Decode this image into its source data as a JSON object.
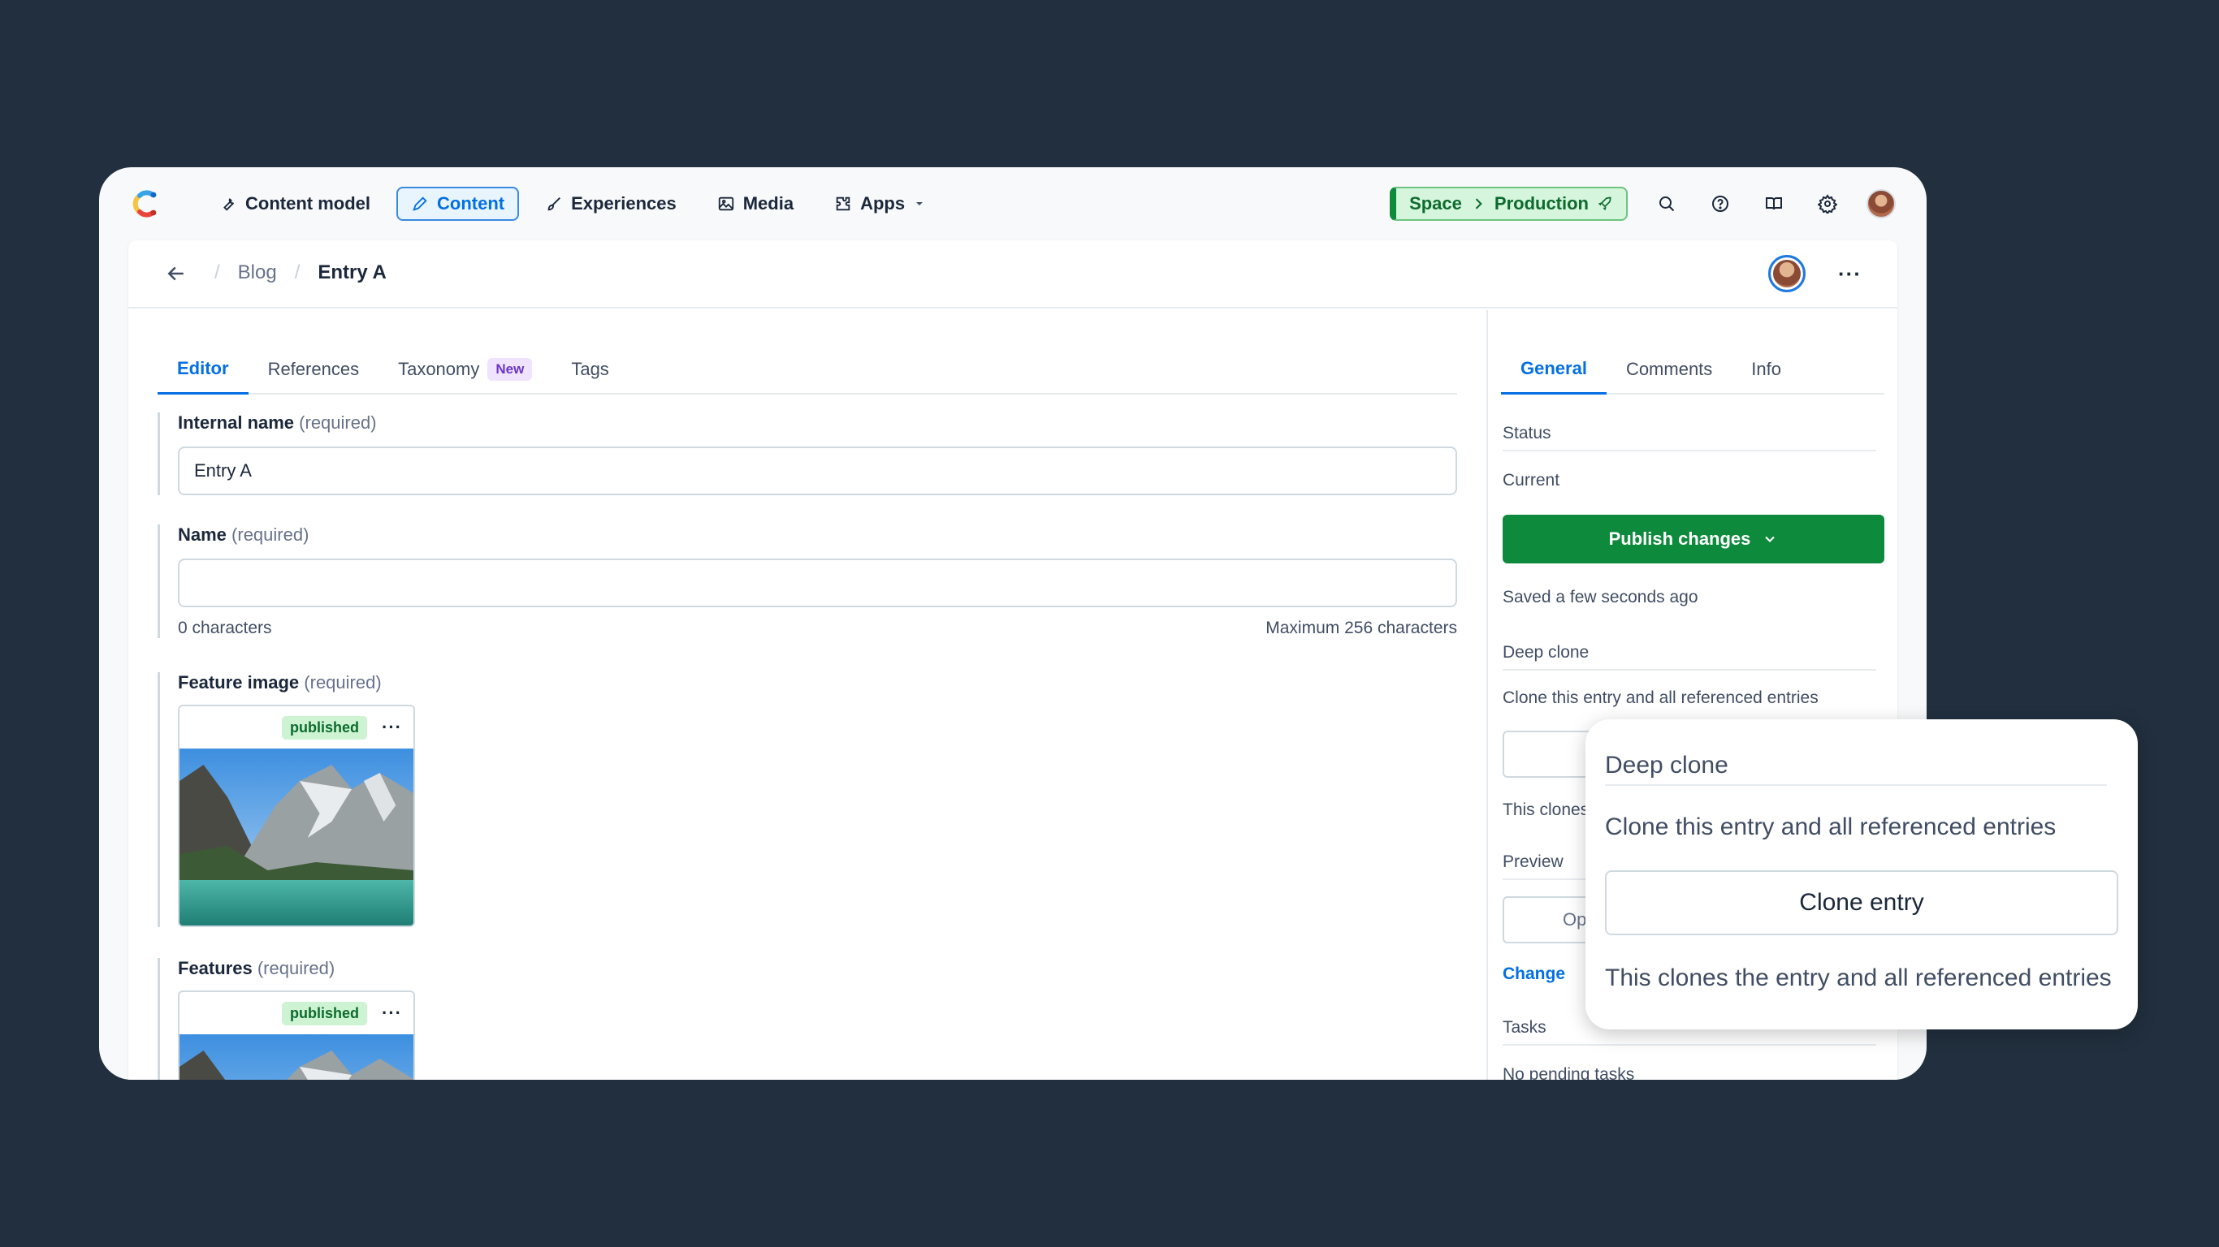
{
  "nav": {
    "items": [
      {
        "label": "Content model",
        "icon": "wrench-icon"
      },
      {
        "label": "Content",
        "icon": "pen-icon",
        "active": true
      },
      {
        "label": "Experiences",
        "icon": "brush-icon"
      },
      {
        "label": "Media",
        "icon": "image-icon"
      },
      {
        "label": "Apps",
        "icon": "puzzle-icon"
      }
    ],
    "environment": {
      "space": "Space",
      "env": "Production"
    }
  },
  "breadcrumb": {
    "parent": "Blog",
    "current": "Entry A"
  },
  "editor": {
    "tabs": [
      {
        "label": "Editor",
        "active": true
      },
      {
        "label": "References"
      },
      {
        "label": "Taxonomy",
        "badge": "New"
      },
      {
        "label": "Tags"
      }
    ],
    "fields": {
      "internal_name": {
        "label": "Internal name",
        "req": "(required)",
        "value": "Entry A"
      },
      "name": {
        "label": "Name",
        "req": "(required)",
        "value": "",
        "count": "0 characters",
        "max": "Maximum 256 characters"
      },
      "feature_image": {
        "label": "Feature image",
        "req": "(required)",
        "status": "published"
      },
      "features": {
        "label": "Features",
        "req": "(required)",
        "status": "published"
      }
    }
  },
  "sidebar": {
    "tabs": [
      {
        "label": "General",
        "active": true
      },
      {
        "label": "Comments"
      },
      {
        "label": "Info"
      }
    ],
    "status_heading": "Status",
    "status_current": "Current",
    "publish_label": "Publish changes",
    "saved_text": "Saved a few seconds ago",
    "deep_clone_heading": "Deep clone",
    "deep_clone_desc": "Clone this entry and all referenced entries",
    "clone_note_partial": "This clones",
    "preview_heading": "Preview",
    "preview_button_partial": "Op",
    "change_link": "Change",
    "tasks_heading": "Tasks",
    "tasks_text": "No pending tasks"
  },
  "popover": {
    "title": "Deep clone",
    "description": "Clone this entry and all referenced entries",
    "button": "Clone entry",
    "note": "This clones the entry and all referenced entries"
  },
  "colors": {
    "background": "#212f3e",
    "primary": "#036fe3",
    "publish": "#0d8a3b"
  }
}
